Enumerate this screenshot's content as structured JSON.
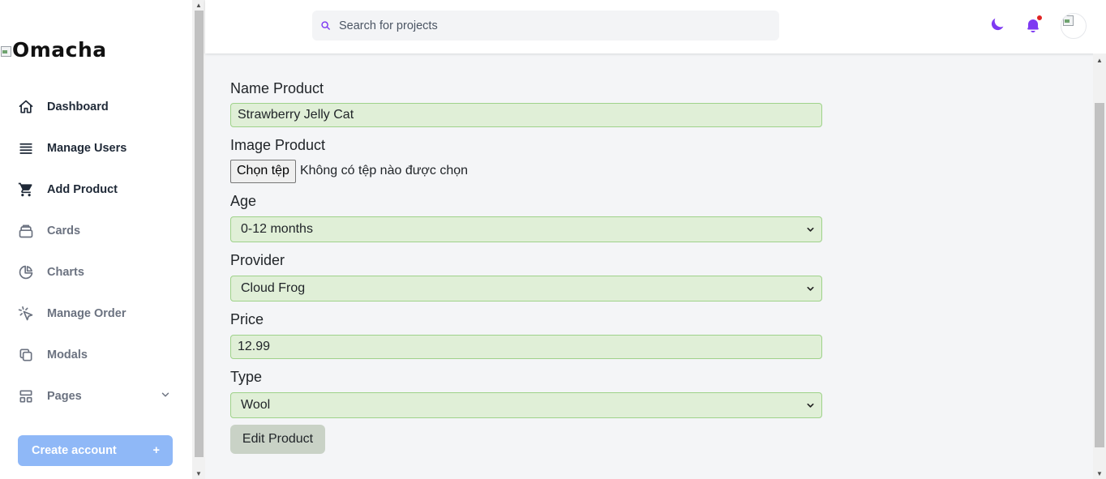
{
  "brand": {
    "logo_text": "Omacha"
  },
  "sidebar": {
    "items": [
      {
        "label": "Dashboard",
        "icon": "home-icon"
      },
      {
        "label": "Manage Users",
        "icon": "list-icon"
      },
      {
        "label": "Add Product",
        "icon": "cart-icon",
        "active": true
      },
      {
        "label": "Cards",
        "icon": "cards-icon"
      },
      {
        "label": "Charts",
        "icon": "pie-chart-icon"
      },
      {
        "label": "Manage Order",
        "icon": "cursor-click-icon"
      },
      {
        "label": "Modals",
        "icon": "copy-icon"
      },
      {
        "label": "Pages",
        "icon": "pages-icon"
      }
    ],
    "create_account": {
      "label": "Create account",
      "plus": "+"
    }
  },
  "header": {
    "search_placeholder": "Search for projects",
    "icons": [
      "moon-icon",
      "bell-icon",
      "avatar"
    ]
  },
  "form": {
    "name": {
      "label": "Name Product",
      "value": "Strawberry Jelly Cat"
    },
    "image": {
      "label": "Image Product",
      "button": "Chọn tệp",
      "status": "Không có tệp nào được chọn"
    },
    "age": {
      "label": "Age",
      "value": "0-12 months"
    },
    "provider": {
      "label": "Provider",
      "value": "Cloud Frog"
    },
    "price": {
      "label": "Price",
      "value": "12.99"
    },
    "type": {
      "label": "Type",
      "value": "Wool"
    },
    "submit": "Edit Product"
  },
  "colors": {
    "accent": "#7e3af2",
    "field_bg": "#e0efd7",
    "field_border": "#9fd28a",
    "create_btn": "#8fb8f7",
    "notification_dot": "#e02424"
  }
}
